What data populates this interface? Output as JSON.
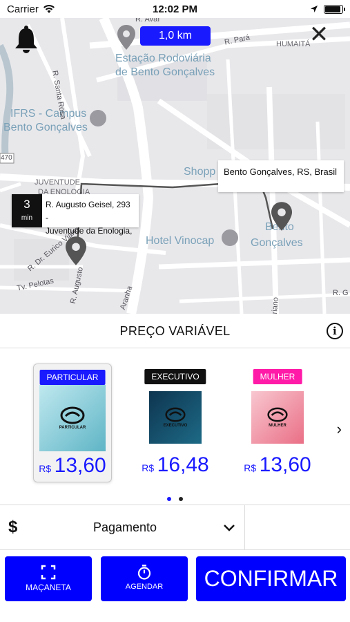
{
  "status_bar": {
    "carrier": "Carrier",
    "time": "12:02 PM"
  },
  "map": {
    "distance": "1,0 km",
    "labels": {
      "station_line1": "Estação Rodoviária",
      "station_line2": "de Bento Gonçalves",
      "ifrs_line1": "IFRS - Campus",
      "ifrs_line2": "Bento Gonçalves",
      "hotel": "Hotel Vinocap",
      "city_line1": "Bento",
      "city_line2": "Gonçalves",
      "shopping": "Shopp",
      "humaita": "HUMAITÁ",
      "juventude_line1": "JUVENTUDE",
      "juventude_line2": "DA ENOLOGIA",
      "road_santa_rosa": "R. Santa Rosa",
      "road_para": "R. Pará",
      "road_avai": "R. Avaí",
      "road_eurico": "R. Dr. Eurico Viann",
      "road_pelotas": "Tv. Pelotas",
      "road_augusto": "R. Augusto",
      "road_aranha": "Aranha",
      "road_mariano": "riano",
      "road_g": "R. G",
      "route_470": "470"
    },
    "destination": "Bento Gonçalves, RS, Brasil",
    "origin": {
      "eta_value": "3",
      "eta_unit": "min",
      "address_line1": "R. Augusto Geisel, 293 -",
      "address_line2": "Juventude da Enologia,"
    }
  },
  "price_header": {
    "title": "PREÇO VARIÁVEL"
  },
  "categories": [
    {
      "name": "PARTICULAR",
      "badge_color": "#1a1aff",
      "image_label": "PARTICULAR",
      "currency": "R$",
      "price": "13,60",
      "selected": true
    },
    {
      "name": "EXECUTIVO",
      "badge_color": "#111111",
      "image_label": "EXECUTIVO",
      "currency": "R$",
      "price": "16,48",
      "selected": false
    },
    {
      "name": "MULHER",
      "badge_color": "#ff1aa8",
      "image_label": "MULHER",
      "currency": "R$",
      "price": "13,60",
      "selected": false
    }
  ],
  "pagination": {
    "active": 0,
    "count": 2
  },
  "payment": {
    "label": "Pagamento"
  },
  "actions": {
    "macaneta": "MAÇANETA",
    "agendar": "AGENDAR",
    "confirm": "CONFIRMAR"
  },
  "colors": {
    "accent": "#0000ff",
    "price_blue": "#1a1aff",
    "pink": "#ff1aa8"
  }
}
